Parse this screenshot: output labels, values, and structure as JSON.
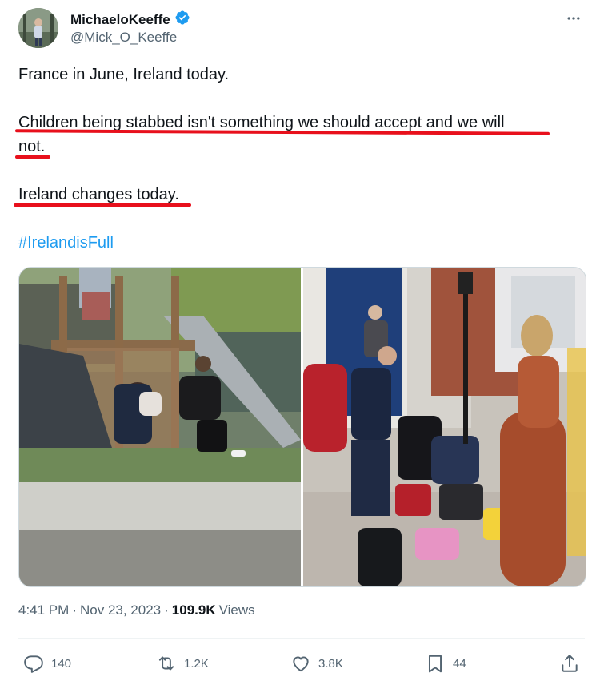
{
  "author": {
    "display_name": "MichaeloKeeffe",
    "handle": "@Mick_O_Keeffe",
    "verified_icon": "verified-badge-icon",
    "verified_color": "#1d9bf0"
  },
  "more_icon": "more-dots-icon",
  "tweet": {
    "line1": "France in June, Ireland today.",
    "line2a": "Children being stabbed isn't something we should accept and we will",
    "line2b": "not.",
    "line3": "Ireland changes today.",
    "hashtag": "#IrelandisFull",
    "hashtag_color": "#1d9bf0",
    "underline_color": "#e8101c"
  },
  "media": {
    "count": 2,
    "images": [
      "playground-altercation-photo",
      "street-emergency-responders-photo"
    ]
  },
  "meta": {
    "time": "4:41 PM",
    "separator": "·",
    "date": "Nov 23, 2023",
    "views_count": "109.9K",
    "views_label": "Views"
  },
  "actions": {
    "reply": {
      "icon": "reply-icon",
      "count": "140"
    },
    "retweet": {
      "icon": "retweet-icon",
      "count": "1.2K"
    },
    "like": {
      "icon": "heart-icon",
      "count": "3.8K"
    },
    "bookmark": {
      "icon": "bookmark-icon",
      "count": "44"
    },
    "share": {
      "icon": "share-icon"
    }
  }
}
